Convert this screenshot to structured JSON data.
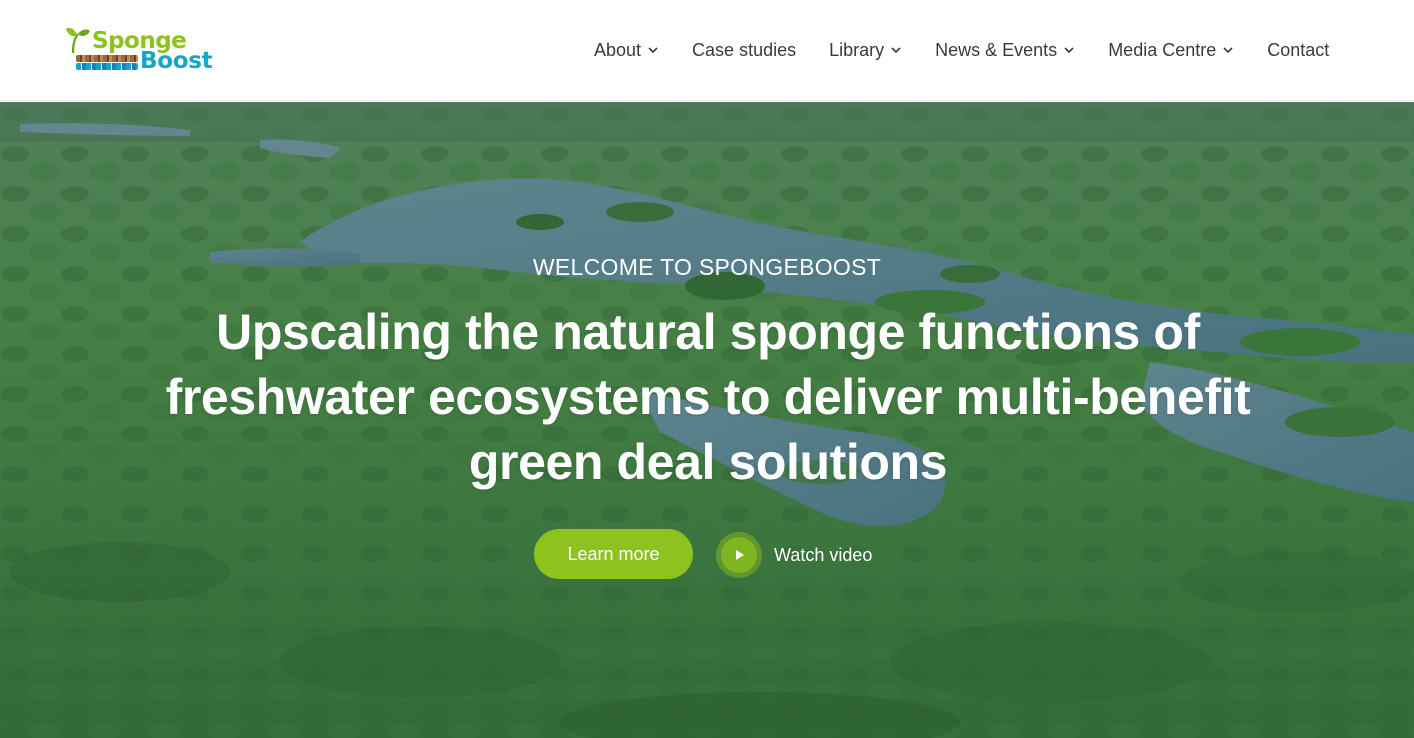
{
  "brand": {
    "logo_line1": "Sponge",
    "logo_line2": "Boost",
    "colors": {
      "green": "#8dc21f",
      "blue": "#12a7c6",
      "brown": "#9b6b3c"
    }
  },
  "nav": {
    "items": [
      {
        "label": "About",
        "has_dropdown": true,
        "icon": "chevron-down-icon"
      },
      {
        "label": "Case studies",
        "has_dropdown": false
      },
      {
        "label": "Library",
        "has_dropdown": true,
        "icon": "chevron-down-icon"
      },
      {
        "label": "News & Events",
        "has_dropdown": true,
        "icon": "chevron-down-icon"
      },
      {
        "label": "Media Centre",
        "has_dropdown": true,
        "icon": "chevron-down-icon"
      },
      {
        "label": "Contact",
        "has_dropdown": false
      }
    ]
  },
  "hero": {
    "eyebrow": "WELCOME TO SPONGEBOOST",
    "headline": "Upscaling the natural sponge functions of freshwater ecosystems to deliver multi-benefit green deal solutions",
    "primary_button": "Learn more",
    "video_link": "Watch video",
    "video_icon": "play-icon",
    "accent_color": "#8dc21f"
  }
}
